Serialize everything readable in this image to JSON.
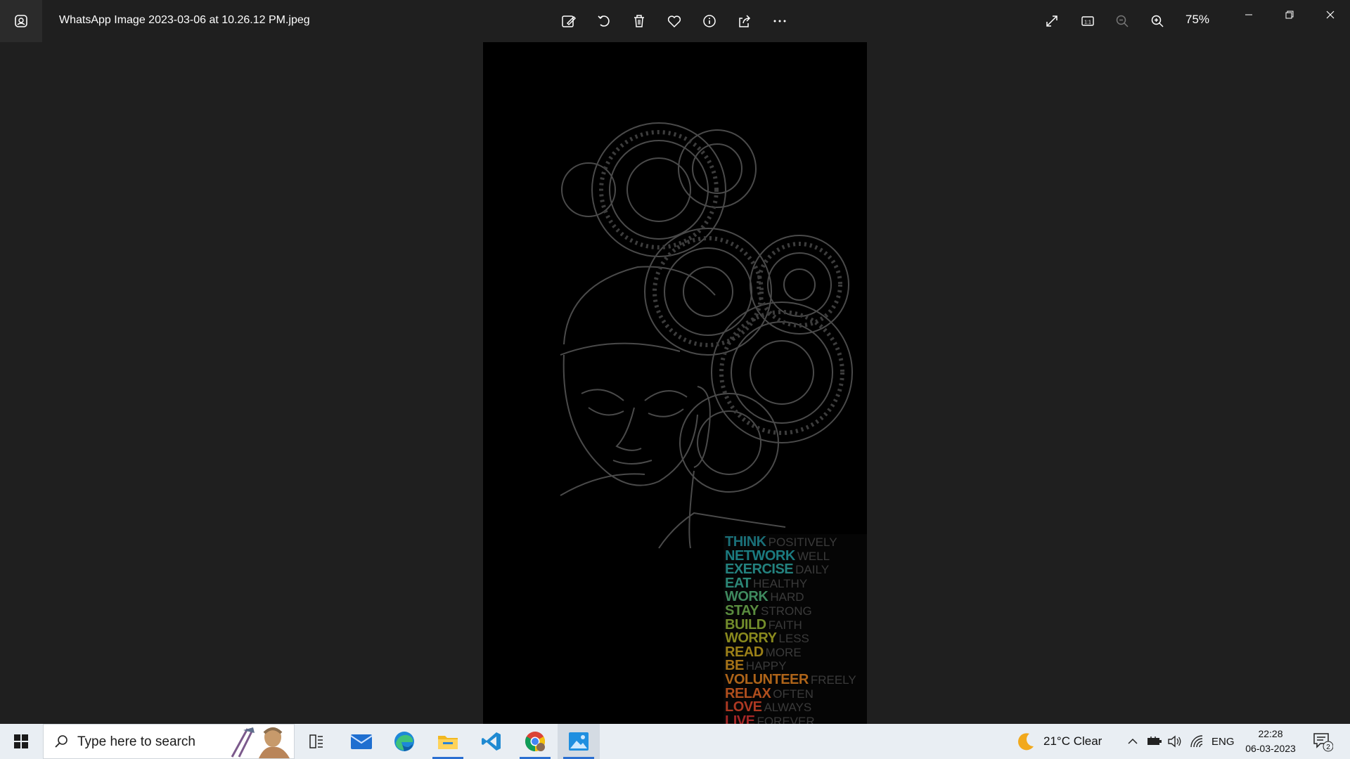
{
  "window": {
    "title": "WhatsApp Image 2023-03-06 at 10.26.12 PM.jpeg",
    "zoom_label": "75%"
  },
  "toolbar": {
    "icons": [
      "edit-icon",
      "rotate-icon",
      "delete-icon",
      "favorite-icon",
      "info-icon",
      "share-icon",
      "more-icon"
    ],
    "right_icons": [
      "fullscreen-icon",
      "actual-size-icon",
      "zoom-out-icon",
      "zoom-in-icon"
    ]
  },
  "photo": {
    "quote_lines": [
      {
        "bold": "THINK",
        "rest": "POSITIVELY",
        "color": "#1a6f78"
      },
      {
        "bold": "NETWORK",
        "rest": "WELL",
        "color": "#1b7b80"
      },
      {
        "bold": "EXERCISE",
        "rest": "DAILY",
        "color": "#23827f"
      },
      {
        "bold": "EAT",
        "rest": "HEALTHY",
        "color": "#2b8676"
      },
      {
        "bold": "WORK",
        "rest": "HARD",
        "color": "#3f8a5f"
      },
      {
        "bold": "STAY",
        "rest": "STRONG",
        "color": "#5a8c3f"
      },
      {
        "bold": "BUILD",
        "rest": "FAITH",
        "color": "#738d2b"
      },
      {
        "bold": "WORRY",
        "rest": "LESS",
        "color": "#8a8a1e"
      },
      {
        "bold": "READ",
        "rest": "MORE",
        "color": "#9b8018"
      },
      {
        "bold": "BE",
        "rest": "HAPPY",
        "color": "#a67318"
      },
      {
        "bold": "VOLUNTEER",
        "rest": "FREELY",
        "color": "#ae6419"
      },
      {
        "bold": "RELAX",
        "rest": "OFTEN",
        "color": "#b04e1d"
      },
      {
        "bold": "LOVE",
        "rest": "ALWAYS",
        "color": "#ad3822"
      },
      {
        "bold": "LIVE",
        "rest": "FOREVER",
        "color": "#a42626"
      }
    ]
  },
  "taskbar": {
    "search_placeholder": "Type here to search",
    "apps": [
      "task-view-icon",
      "mail-icon",
      "edge-icon",
      "file-explorer-icon",
      "vscode-icon",
      "chrome-icon",
      "photos-icon"
    ],
    "weather": "21°C  Clear",
    "language": "ENG",
    "time": "22:28",
    "date": "06-03-2023",
    "notification_count": "2"
  },
  "colors": {
    "accent": "#2b6fd1",
    "titlebar_bg": "#1f1f1f",
    "taskbar_bg": "#e9eef3"
  }
}
